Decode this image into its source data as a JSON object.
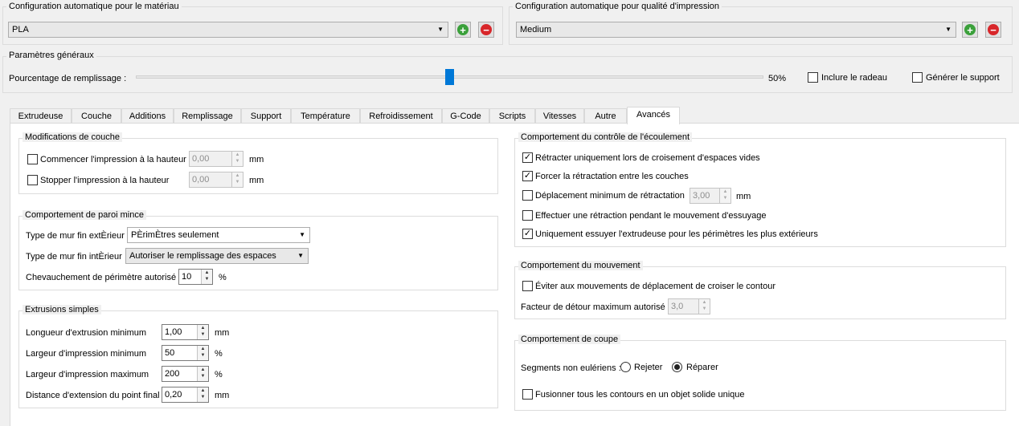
{
  "material": {
    "title": "Configuration automatique pour le matériau",
    "selected": "PLA"
  },
  "quality": {
    "title": "Configuration automatique pour qualité d'impression",
    "selected": "Medium"
  },
  "general": {
    "title": "Paramètres généraux",
    "infill_label": "Pourcentage de remplissage :",
    "infill_value": "50%",
    "infill_fraction": 0.5,
    "raft_label": "Inclure le radeau",
    "support_label": "Générer le support"
  },
  "tabs": [
    "Extrudeuse",
    "Couche",
    "Additions",
    "Remplissage",
    "Support",
    "Température",
    "Refroidissement",
    "G-Code",
    "Scripts",
    "Vitesses",
    "Autre",
    "Avancés"
  ],
  "layer_mods": {
    "title": "Modifications de couche",
    "start_label": "Commencer l'impression à la hauteur",
    "start_value": "0,00",
    "stop_label": "Stopper  l'impression à la hauteur",
    "stop_value": "0,00",
    "unit": "mm"
  },
  "thin_wall": {
    "title": "Comportement de paroi mince",
    "ext_label": "Type de mur fin extÈrieur",
    "ext_value": "PÈrimÈtres seulement",
    "int_label": "Type de mur fin intÈrieur",
    "int_value": "Autoriser le remplissage des espaces",
    "overlap_label": "Chevauchement de périmètre autorisé",
    "overlap_value": "10",
    "overlap_unit": "%"
  },
  "simple_extrusions": {
    "title": "Extrusions simples",
    "rows": [
      {
        "label": "Longueur d'extrusion minimum",
        "value": "1,00",
        "unit": "mm"
      },
      {
        "label": "Largeur d'impression minimum",
        "value": "50",
        "unit": "%"
      },
      {
        "label": "Largeur d'impression maximum",
        "value": "200",
        "unit": "%"
      },
      {
        "label": "Distance d'extension du point final",
        "value": "0,20",
        "unit": "mm"
      }
    ]
  },
  "flow_control": {
    "title": "Comportement du contrôle de l'écoulement",
    "item1": "Rétracter uniquement lors de croisement d'espaces vides",
    "item2": "Forcer la rétractation entre les couches",
    "item3": "Déplacement minimum de rétractation",
    "item3_value": "3,00",
    "item3_unit": "mm",
    "item4": "Effectuer une rétraction pendant le mouvement d'essuyage",
    "item5": "Uniquement essuyer l'extrudeuse pour les périmètres les plus extérieurs"
  },
  "movement": {
    "title": "Comportement du mouvement",
    "avoid_label": "Éviter aux mouvements de déplacement de croiser le contour",
    "detour_label": "Facteur de détour maximum autorisé",
    "detour_value": "3,0"
  },
  "cut": {
    "title": "Comportement de coupe",
    "segments_label": "Segments non eulériens :",
    "reject_label": "Rejeter",
    "repair_label": "Réparer",
    "merge_label": "Fusionner tous les contours en un objet solide unique"
  },
  "colors": {
    "accent": "#0078d7",
    "add_green": "#3aa03a",
    "remove_red": "#d8262a"
  }
}
